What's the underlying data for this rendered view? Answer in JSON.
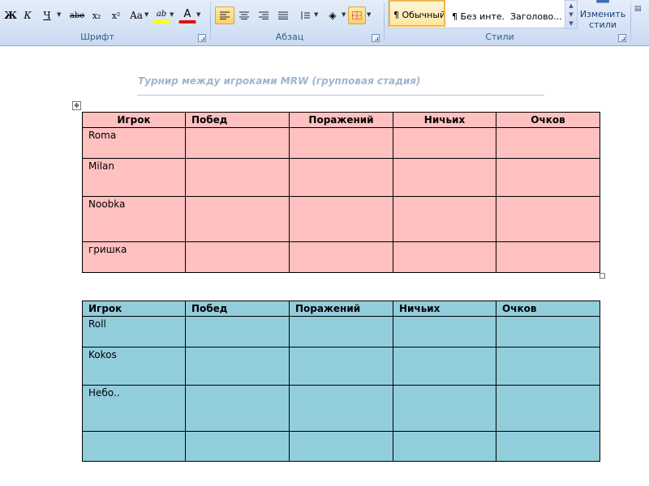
{
  "ribbon": {
    "font_group": {
      "label": "Шрифт",
      "bold": "Ж",
      "italic": "К",
      "underline": "Ч",
      "strikethrough": "abe",
      "subscript": "x₂",
      "superscript": "x²",
      "change_case": "Aa",
      "highlight": "ab",
      "font_color": "A"
    },
    "paragraph_group": {
      "label": "Абзац"
    },
    "styles_group": {
      "label": "Стили",
      "styles": [
        "¶ Обычный",
        "¶ Без инте...",
        "Заголово..."
      ],
      "change_styles": "Изменить стили"
    }
  },
  "document": {
    "title": "Турнир между игроками MRW (групповая стадия)",
    "table1": {
      "headers": [
        "Игрок",
        "Побед",
        "Поражений",
        "Ничьих",
        "Очков"
      ],
      "rows": [
        [
          "Roma",
          "",
          "",
          "",
          ""
        ],
        [
          "Milan",
          "",
          "",
          "",
          ""
        ],
        [
          "Noobka",
          "",
          "",
          "",
          ""
        ],
        [
          "гришка",
          "",
          "",
          "",
          ""
        ]
      ]
    },
    "table2": {
      "headers": [
        "Игрок",
        "Побед",
        "Поражений",
        "Ничьих",
        "Очков"
      ],
      "rows": [
        [
          "Roll",
          "",
          "",
          "",
          ""
        ],
        [
          "Kokos",
          "",
          "",
          "",
          ""
        ],
        [
          "Небо..",
          "",
          "",
          "",
          ""
        ],
        [
          "",
          "",
          "",
          "",
          ""
        ]
      ]
    }
  },
  "colors": {
    "table1_fill": "#ffc0c0",
    "table2_fill": "#92cddc",
    "title_color": "#9eb5d2",
    "ribbon_bg": "#d7e4f5"
  }
}
